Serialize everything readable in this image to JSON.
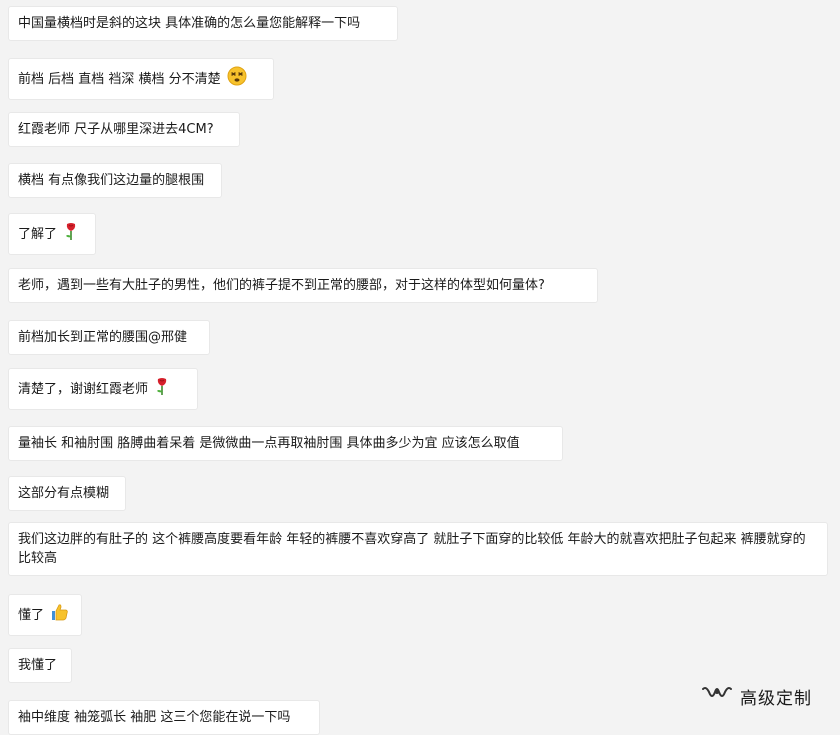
{
  "messages": [
    {
      "text": "中国量横档时是斜的这块 具体准确的怎么量您能解释一下吗",
      "emoji": ""
    },
    {
      "text": "前档  后档 直档 裆深 横档 分不清楚",
      "emoji": "dizzy-face"
    },
    {
      "text": "红霞老师 尺子从哪里深进去4CM?",
      "emoji": ""
    },
    {
      "text": "横档 有点像我们这边量的腿根围",
      "emoji": ""
    },
    {
      "text": "了解了",
      "emoji": "rose"
    },
    {
      "text": "老师，遇到一些有大肚子的男性，他们的裤子提不到正常的腰部，对于这样的体型如何量体?",
      "emoji": ""
    },
    {
      "text": "前档加长到正常的腰围@邢健",
      "emoji": ""
    },
    {
      "text": "清楚了，谢谢红霞老师",
      "emoji": "rose"
    },
    {
      "text": "量袖长 和袖肘围 胳膊曲着呆着 是微微曲一点再取袖肘围 具体曲多少为宜 应该怎么取值",
      "emoji": ""
    },
    {
      "text": "这部分有点模糊",
      "emoji": ""
    },
    {
      "text": "我们这边胖的有肚子的  这个裤腰高度要看年龄 年轻的裤腰不喜欢穿高了 就肚子下面穿的比较低   年龄大的就喜欢把肚子包起来 裤腰就穿的比较高",
      "emoji": ""
    },
    {
      "text": "懂了",
      "emoji": "thumbs-up"
    },
    {
      "text": "我懂了",
      "emoji": ""
    },
    {
      "text": "袖中维度  袖笼弧长 袖肥 这三个您能在说一下吗",
      "emoji": ""
    }
  ],
  "watermark": {
    "text": "高级定制",
    "icon": "wechat-channel-icon"
  }
}
